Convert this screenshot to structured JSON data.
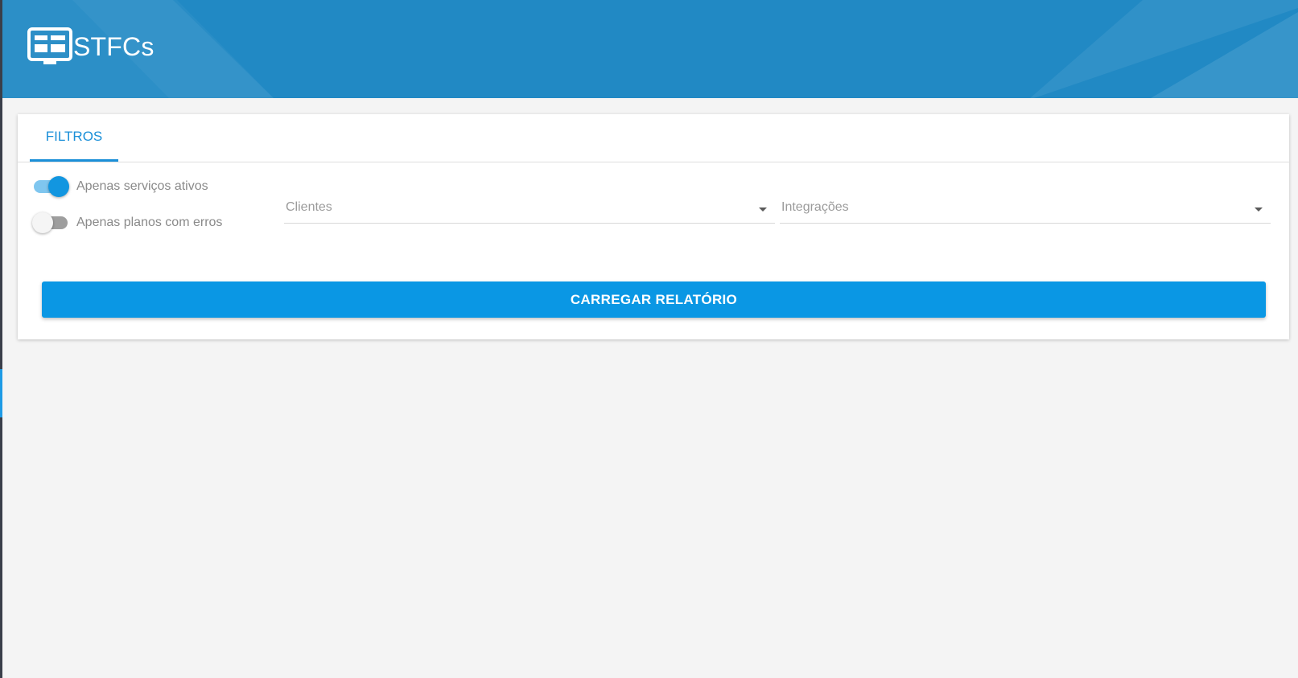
{
  "app": {
    "title": "STFCs",
    "logo_icon": "dashboard-monitor-icon"
  },
  "colors": {
    "header": "#2189c4",
    "accent": "#1a8fd8",
    "button": "#0a97e4",
    "background": "#f4f4f4"
  },
  "tabs": [
    {
      "label": "FILTROS",
      "active": true
    }
  ],
  "filters": {
    "toggles": [
      {
        "label": "Apenas serviços ativos",
        "checked": true
      },
      {
        "label": "Apenas planos com erros",
        "checked": false
      }
    ],
    "selects": [
      {
        "placeholder": "Clientes",
        "value": "",
        "icon": "dropdown-caret-icon"
      },
      {
        "placeholder": "Integrações",
        "value": "",
        "icon": "dropdown-caret-icon"
      }
    ]
  },
  "actions": {
    "load_report_label": "CARREGAR RELATÓRIO"
  }
}
